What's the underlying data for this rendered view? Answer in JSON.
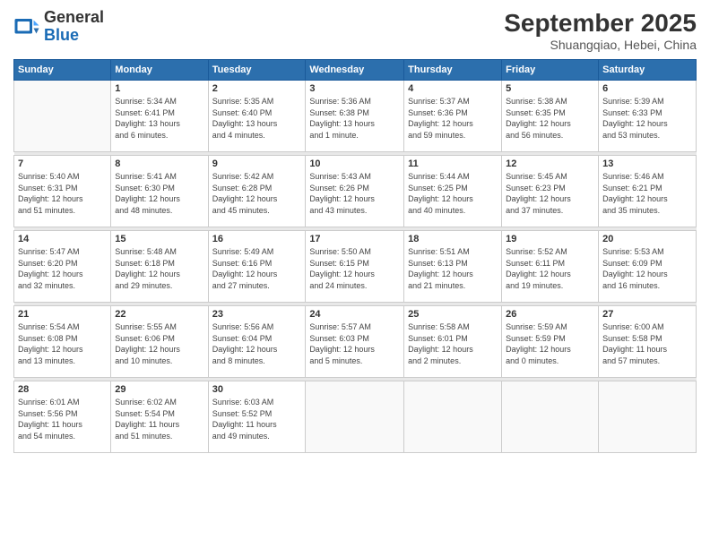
{
  "logo": {
    "line1": "General",
    "line2": "Blue"
  },
  "title": "September 2025",
  "subtitle": "Shuangqiao, Hebei, China",
  "days_header": [
    "Sunday",
    "Monday",
    "Tuesday",
    "Wednesday",
    "Thursday",
    "Friday",
    "Saturday"
  ],
  "weeks": [
    [
      {
        "num": "",
        "info": ""
      },
      {
        "num": "1",
        "info": "Sunrise: 5:34 AM\nSunset: 6:41 PM\nDaylight: 13 hours\nand 6 minutes."
      },
      {
        "num": "2",
        "info": "Sunrise: 5:35 AM\nSunset: 6:40 PM\nDaylight: 13 hours\nand 4 minutes."
      },
      {
        "num": "3",
        "info": "Sunrise: 5:36 AM\nSunset: 6:38 PM\nDaylight: 13 hours\nand 1 minute."
      },
      {
        "num": "4",
        "info": "Sunrise: 5:37 AM\nSunset: 6:36 PM\nDaylight: 12 hours\nand 59 minutes."
      },
      {
        "num": "5",
        "info": "Sunrise: 5:38 AM\nSunset: 6:35 PM\nDaylight: 12 hours\nand 56 minutes."
      },
      {
        "num": "6",
        "info": "Sunrise: 5:39 AM\nSunset: 6:33 PM\nDaylight: 12 hours\nand 53 minutes."
      }
    ],
    [
      {
        "num": "7",
        "info": "Sunrise: 5:40 AM\nSunset: 6:31 PM\nDaylight: 12 hours\nand 51 minutes."
      },
      {
        "num": "8",
        "info": "Sunrise: 5:41 AM\nSunset: 6:30 PM\nDaylight: 12 hours\nand 48 minutes."
      },
      {
        "num": "9",
        "info": "Sunrise: 5:42 AM\nSunset: 6:28 PM\nDaylight: 12 hours\nand 45 minutes."
      },
      {
        "num": "10",
        "info": "Sunrise: 5:43 AM\nSunset: 6:26 PM\nDaylight: 12 hours\nand 43 minutes."
      },
      {
        "num": "11",
        "info": "Sunrise: 5:44 AM\nSunset: 6:25 PM\nDaylight: 12 hours\nand 40 minutes."
      },
      {
        "num": "12",
        "info": "Sunrise: 5:45 AM\nSunset: 6:23 PM\nDaylight: 12 hours\nand 37 minutes."
      },
      {
        "num": "13",
        "info": "Sunrise: 5:46 AM\nSunset: 6:21 PM\nDaylight: 12 hours\nand 35 minutes."
      }
    ],
    [
      {
        "num": "14",
        "info": "Sunrise: 5:47 AM\nSunset: 6:20 PM\nDaylight: 12 hours\nand 32 minutes."
      },
      {
        "num": "15",
        "info": "Sunrise: 5:48 AM\nSunset: 6:18 PM\nDaylight: 12 hours\nand 29 minutes."
      },
      {
        "num": "16",
        "info": "Sunrise: 5:49 AM\nSunset: 6:16 PM\nDaylight: 12 hours\nand 27 minutes."
      },
      {
        "num": "17",
        "info": "Sunrise: 5:50 AM\nSunset: 6:15 PM\nDaylight: 12 hours\nand 24 minutes."
      },
      {
        "num": "18",
        "info": "Sunrise: 5:51 AM\nSunset: 6:13 PM\nDaylight: 12 hours\nand 21 minutes."
      },
      {
        "num": "19",
        "info": "Sunrise: 5:52 AM\nSunset: 6:11 PM\nDaylight: 12 hours\nand 19 minutes."
      },
      {
        "num": "20",
        "info": "Sunrise: 5:53 AM\nSunset: 6:09 PM\nDaylight: 12 hours\nand 16 minutes."
      }
    ],
    [
      {
        "num": "21",
        "info": "Sunrise: 5:54 AM\nSunset: 6:08 PM\nDaylight: 12 hours\nand 13 minutes."
      },
      {
        "num": "22",
        "info": "Sunrise: 5:55 AM\nSunset: 6:06 PM\nDaylight: 12 hours\nand 10 minutes."
      },
      {
        "num": "23",
        "info": "Sunrise: 5:56 AM\nSunset: 6:04 PM\nDaylight: 12 hours\nand 8 minutes."
      },
      {
        "num": "24",
        "info": "Sunrise: 5:57 AM\nSunset: 6:03 PM\nDaylight: 12 hours\nand 5 minutes."
      },
      {
        "num": "25",
        "info": "Sunrise: 5:58 AM\nSunset: 6:01 PM\nDaylight: 12 hours\nand 2 minutes."
      },
      {
        "num": "26",
        "info": "Sunrise: 5:59 AM\nSunset: 5:59 PM\nDaylight: 12 hours\nand 0 minutes."
      },
      {
        "num": "27",
        "info": "Sunrise: 6:00 AM\nSunset: 5:58 PM\nDaylight: 11 hours\nand 57 minutes."
      }
    ],
    [
      {
        "num": "28",
        "info": "Sunrise: 6:01 AM\nSunset: 5:56 PM\nDaylight: 11 hours\nand 54 minutes."
      },
      {
        "num": "29",
        "info": "Sunrise: 6:02 AM\nSunset: 5:54 PM\nDaylight: 11 hours\nand 51 minutes."
      },
      {
        "num": "30",
        "info": "Sunrise: 6:03 AM\nSunset: 5:52 PM\nDaylight: 11 hours\nand 49 minutes."
      },
      {
        "num": "",
        "info": ""
      },
      {
        "num": "",
        "info": ""
      },
      {
        "num": "",
        "info": ""
      },
      {
        "num": "",
        "info": ""
      }
    ]
  ]
}
